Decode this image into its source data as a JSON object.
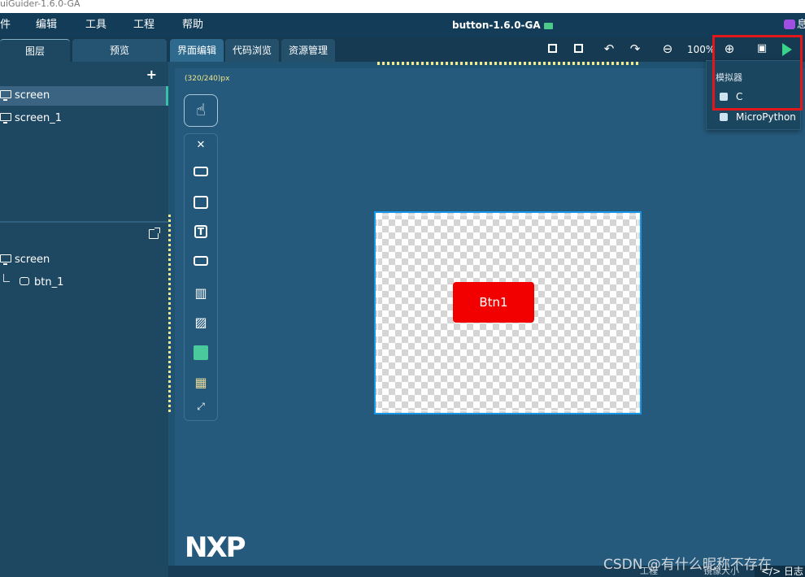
{
  "window": {
    "title": "uiGuider-1.6.0-GA"
  },
  "menu": {
    "items": [
      "件",
      "编辑",
      "工具",
      "工程",
      "帮助"
    ],
    "project_title": "button-1.6.0-GA",
    "right_text": "息"
  },
  "left_tabs": [
    "图层",
    "预览"
  ],
  "layers_panel": {
    "screens": [
      "screen",
      "screen_1"
    ],
    "selected_index": 0
  },
  "widget_tree": {
    "root": "screen",
    "children": [
      "btn_1"
    ]
  },
  "editor_tabs": [
    "界面编辑",
    "代码浏览",
    "资源管理"
  ],
  "toolbar": {
    "zoom": "100%"
  },
  "canvas": {
    "dimensions_label": "(320/240)px"
  },
  "screen_widget": {
    "button_label": "Btn1"
  },
  "logo": {
    "text": "NXP"
  },
  "dropdown": {
    "header": "模拟器",
    "items": [
      "C",
      "MicroPython"
    ]
  },
  "bottom_bar": {
    "items": [
      "工程",
      "镜像大小"
    ],
    "log_label": "日志"
  },
  "watermark": "CSDN @有什么昵称不存在",
  "colors": {
    "accent": "#36c3a5",
    "button_red": "#f20000",
    "highlight_red": "#e3171a",
    "play_green": "#39d48a"
  }
}
